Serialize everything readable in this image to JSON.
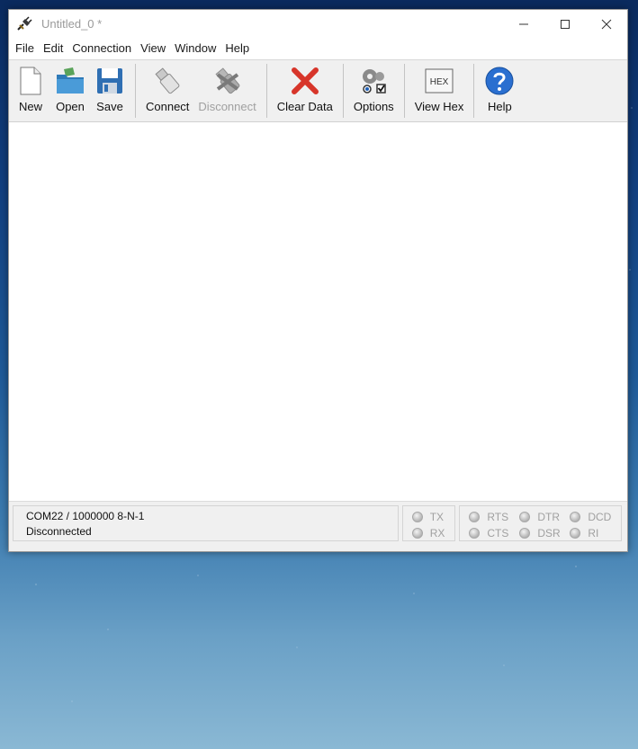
{
  "window": {
    "title": "Untitled_0 *",
    "controls": {
      "minimize": "—",
      "maximize": "☐",
      "close": "✕"
    }
  },
  "menu": [
    "File",
    "Edit",
    "Connection",
    "View",
    "Window",
    "Help"
  ],
  "toolbar": {
    "new": "New",
    "open": "Open",
    "save": "Save",
    "connect": "Connect",
    "disconnect": "Disconnect",
    "clear": "Clear Data",
    "options": "Options",
    "view_hex": "View Hex",
    "hex_icon_text": "HEX",
    "help": "Help"
  },
  "status": {
    "port": "COM22 / 1000000 8-N-1",
    "state": "Disconnected",
    "leds_data": [
      "TX",
      "RX"
    ],
    "leds_lines": [
      "RTS",
      "DTR",
      "DCD",
      "CTS",
      "DSR",
      "RI"
    ]
  },
  "colors": {
    "disabled_text": "#a0a0a0",
    "clear_red": "#d7352a",
    "help_blue": "#2a6fd0"
  }
}
